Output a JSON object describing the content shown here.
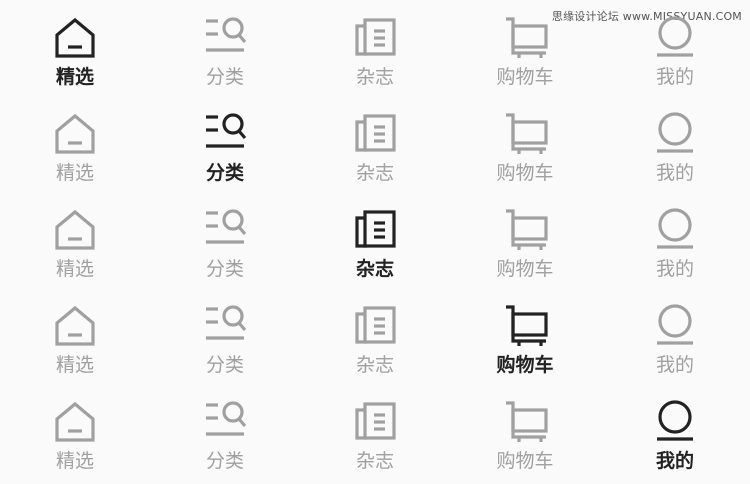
{
  "watermark": "思缘设计论坛 www.MISSYUAN.COM",
  "colors": {
    "background": "#fafafa",
    "active": "#222222",
    "inactive": "#a0a0a0"
  },
  "tabs": [
    {
      "id": "featured",
      "label": "精选",
      "icon": "home-icon"
    },
    {
      "id": "category",
      "label": "分类",
      "icon": "category-search-icon"
    },
    {
      "id": "magazine",
      "label": "杂志",
      "icon": "magazine-icon"
    },
    {
      "id": "cart",
      "label": "购物车",
      "icon": "cart-icon"
    },
    {
      "id": "mine",
      "label": "我的",
      "icon": "profile-icon"
    }
  ],
  "rows": [
    {
      "active_tab": "精选"
    },
    {
      "active_tab": "分类"
    },
    {
      "active_tab": "杂志"
    },
    {
      "active_tab": "购物车"
    },
    {
      "active_tab": "我的"
    }
  ]
}
